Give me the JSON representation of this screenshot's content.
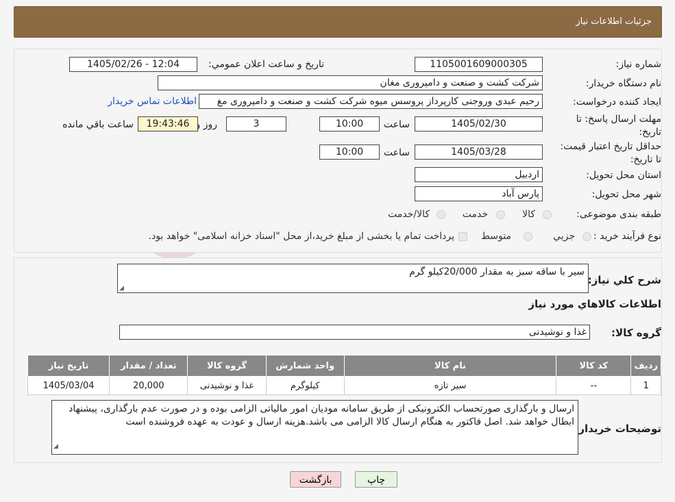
{
  "header": {
    "title": "جزئیات اطلاعات نیاز"
  },
  "fields": {
    "need_number_label": "شماره نیاز:",
    "need_number": "1105001609000305",
    "announce_label": "تاریخ و ساعت اعلان عمومي:",
    "announce_value": "1405/02/26 - 12:04",
    "buyer_org_label": "نام دستگاه خریدار:",
    "buyer_org": "شرکت کشت و صنعت و دامپروری مغان",
    "requester_label": "ایجاد کننده درخواست:",
    "requester": "رحیم عبدی وروجنی کارپرداز پروسس میوه شرکت کشت و صنعت و دامپروری مغ",
    "contact_link": "اطلاعات تماس خریدار",
    "reply_deadline_label": "مهلت ارسال پاسخ: تا تاریخ:",
    "reply_date": "1405/02/30",
    "time_label": "ساعت",
    "reply_time": "10:00",
    "days": "3",
    "days_label": "روز و",
    "remaining_time": "19:43:46",
    "remaining_label": "ساعت باقي مانده",
    "price_validity_label": "حداقل تاریخ اعتبار قیمت: تا تاریخ:",
    "price_date": "1405/03/28",
    "price_time": "10:00",
    "province_label": "استان محل تحویل:",
    "province": "اردبیل",
    "city_label": "شهر محل تحویل:",
    "city": "پارس آباد",
    "category_label": "طبقه بندی موضوعی:",
    "category_options": [
      "کالا",
      "خدمت",
      "کالا/خدمت"
    ],
    "process_label": "نوع فرآیند خرید :",
    "process_options": [
      "جزيي",
      "متوسط"
    ],
    "payment_note": "پرداخت تمام یا بخشی از مبلغ خرید،از محل \"اسناد خزانه اسلامی\" خواهد بود."
  },
  "summary": {
    "label": "شرح کلي نیاز:",
    "text": "سیر با ساقه سبز به مقدار 20/000کیلو گرم",
    "goods_info_title": "اطلاعات کالاهاي مورد نیاز",
    "goods_group_label": "گروه کالا:",
    "goods_group": "غذا و نوشیدنی"
  },
  "table": {
    "headers": [
      "ردیف",
      "کد کالا",
      "نام کالا",
      "واحد شمارش",
      "گروه کالا",
      "تعداد / مقدار",
      "تاریخ نیاز"
    ],
    "rows": [
      [
        "1",
        "--",
        "سیر تازه",
        "کیلوگرم",
        "غذا و نوشیدنی",
        "20,000",
        "1405/03/04"
      ]
    ]
  },
  "notes": {
    "label": "توضیحات خریدار:",
    "text": "ارسال و بارگذاری صورتحساب الکترونیکی از طریق سامانه مودیان امور مالیاتی الزامی بوده و در صورت عدم بارگذاری، پیشنهاد ابطال خواهد شد. اصل فاکتور به هنگام ارسال کالا  الزامی می باشد.هزینه ارسال و عودت به عهده فروشنده است"
  },
  "buttons": {
    "print": "چاپ",
    "back": "بازگشت"
  },
  "watermark": {
    "text": "AriaTender.neT"
  },
  "colors": {
    "header": "#8b6a44",
    "back_button": "#f7d6d6",
    "print_button": "#e4f5e0",
    "link": "#1c4fb8",
    "table_header": "#888888"
  }
}
